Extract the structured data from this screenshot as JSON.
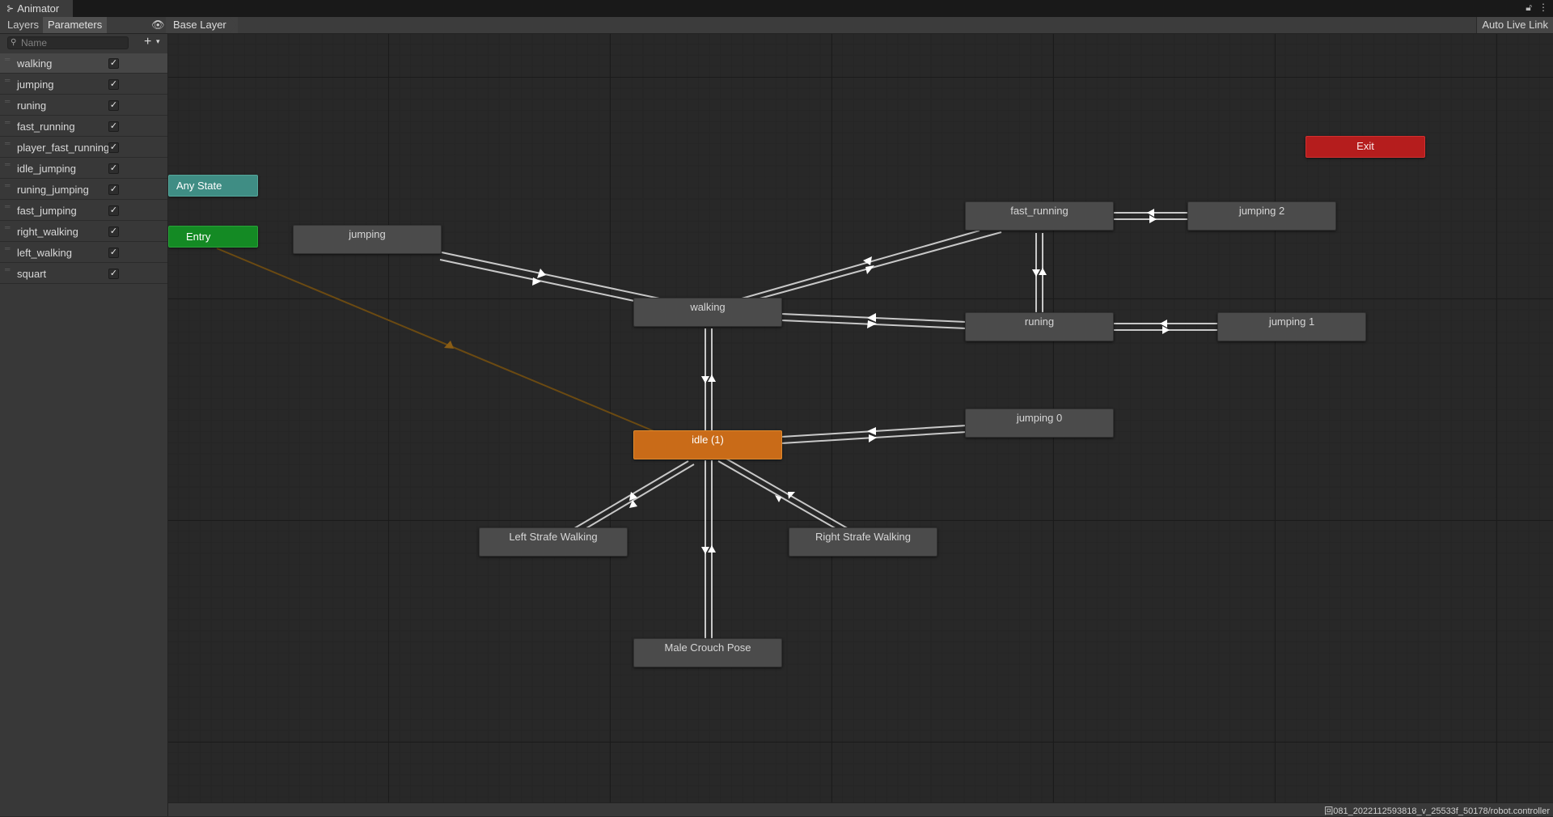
{
  "window": {
    "title": "Animator",
    "tab_icon": "animator-icon",
    "lock_icon": "lock-icon",
    "menu_icon": "kebab-menu-icon"
  },
  "toolbar": {
    "layers_tab": "Layers",
    "parameters_tab": "Parameters",
    "eye_icon": "eye-icon",
    "breadcrumb": "Base Layer",
    "auto_live_link": "Auto Live Link"
  },
  "sidebar": {
    "search_placeholder": "Name",
    "search_icon": "search-icon",
    "add_icon": "plus-icon",
    "parameters": [
      {
        "name": "walking",
        "checked": true
      },
      {
        "name": "jumping",
        "checked": true
      },
      {
        "name": "runing",
        "checked": true
      },
      {
        "name": "fast_running",
        "checked": true
      },
      {
        "name": "player_fast_running",
        "checked": true
      },
      {
        "name": "idle_jumping",
        "checked": true
      },
      {
        "name": "runing_jumping",
        "checked": true
      },
      {
        "name": "fast_jumping",
        "checked": true
      },
      {
        "name": "right_walking",
        "checked": true
      },
      {
        "name": "left_walking",
        "checked": true
      },
      {
        "name": "squart",
        "checked": true
      }
    ]
  },
  "graph": {
    "states": {
      "any_state": "Any State",
      "entry": "Entry",
      "exit": "Exit",
      "jumping": "jumping",
      "walking": "walking",
      "idle": "idle (1)",
      "fast_running": "fast_running",
      "jumping_2": "jumping 2",
      "runing": "runing",
      "jumping_1": "jumping 1",
      "jumping_0": "jumping 0",
      "left_strafe": "Left Strafe Walking",
      "right_strafe": "Right Strafe Walking",
      "crouch": "Male Crouch Pose"
    },
    "colors": {
      "default_state": "#4b4b4b",
      "default_state_orange": "#c96b18",
      "entry": "#148a24",
      "any_state": "#3f8d84",
      "exit": "#b51d1d",
      "transition": "#c8c8c8",
      "entry_transition": "#6b4a12"
    }
  },
  "status": {
    "path": "回081_2022112593818_v_25533f_50178/robot.controller"
  }
}
